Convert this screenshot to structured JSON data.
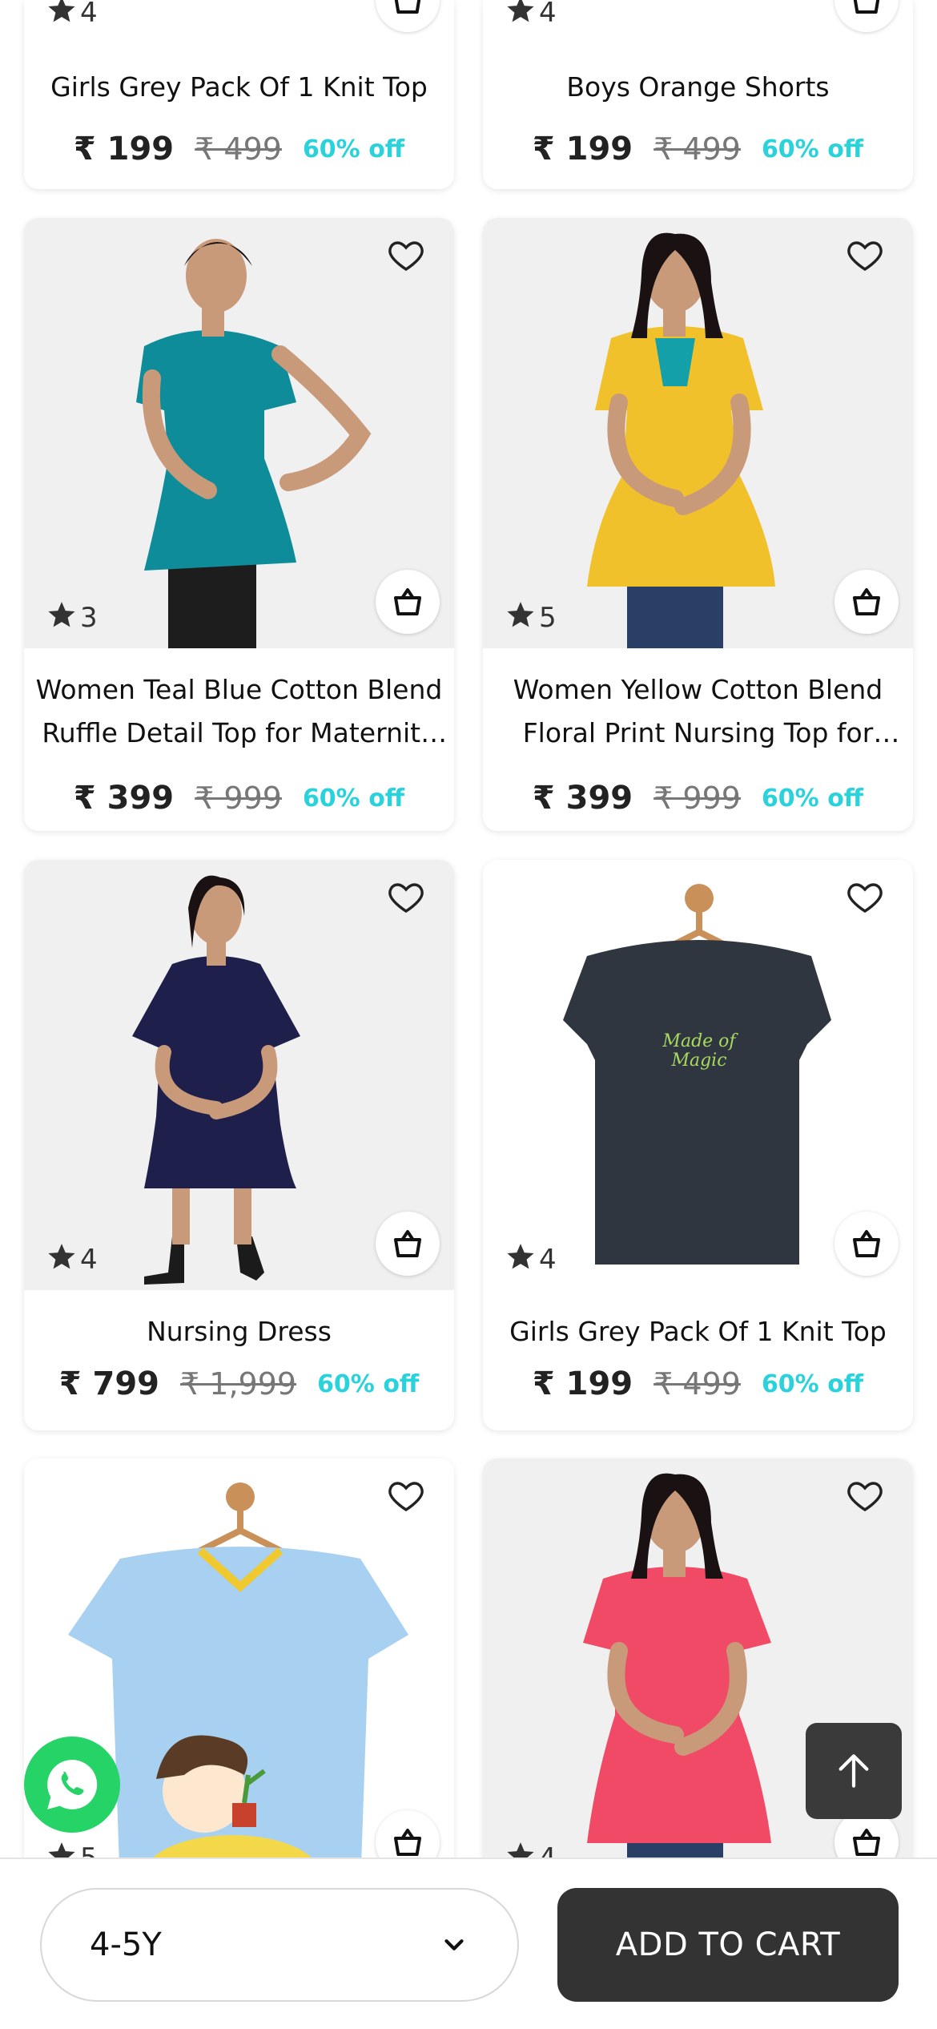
{
  "currency_symbol": "₹",
  "colors": {
    "accent_discount": "#2ad2dc",
    "button_dark": "#333333",
    "whatsapp": "#25d366"
  },
  "partial_cards": [
    {
      "rating": "4",
      "title": "Girls Grey Pack Of 1 Knit Top",
      "price": "₹ 199",
      "mrp": "₹ 499",
      "discount": "60% off"
    },
    {
      "rating": "4",
      "title": "Boys Orange Shorts",
      "price": "₹ 199",
      "mrp": "₹ 499",
      "discount": "60% off"
    }
  ],
  "products": [
    {
      "rating": "3",
      "title": "Women Teal Blue Cotton Blend Ruffle Detail Top for Maternity Wear",
      "price": "₹ 399",
      "mrp": "₹ 999",
      "discount": "60% off"
    },
    {
      "rating": "5",
      "title": "Women Yellow Cotton Blend Floral Print Nursing Top for Maternity Wear",
      "price": "₹ 399",
      "mrp": "₹ 999",
      "discount": "60% off"
    },
    {
      "rating": "4",
      "title": "Nursing Dress",
      "price": "₹ 799",
      "mrp": "₹ 1,999",
      "discount": "60% off"
    },
    {
      "rating": "4",
      "title": "Girls Grey Pack Of 1 Knit Top",
      "price": "₹ 199",
      "mrp": "₹ 499",
      "discount": "60% off"
    },
    {
      "rating": "5"
    },
    {
      "rating": "4"
    }
  ],
  "tshirt_print_text": "Made of Magic",
  "bottom_bar": {
    "size_value": "4-5Y",
    "add_to_cart_label": "ADD TO CART"
  }
}
